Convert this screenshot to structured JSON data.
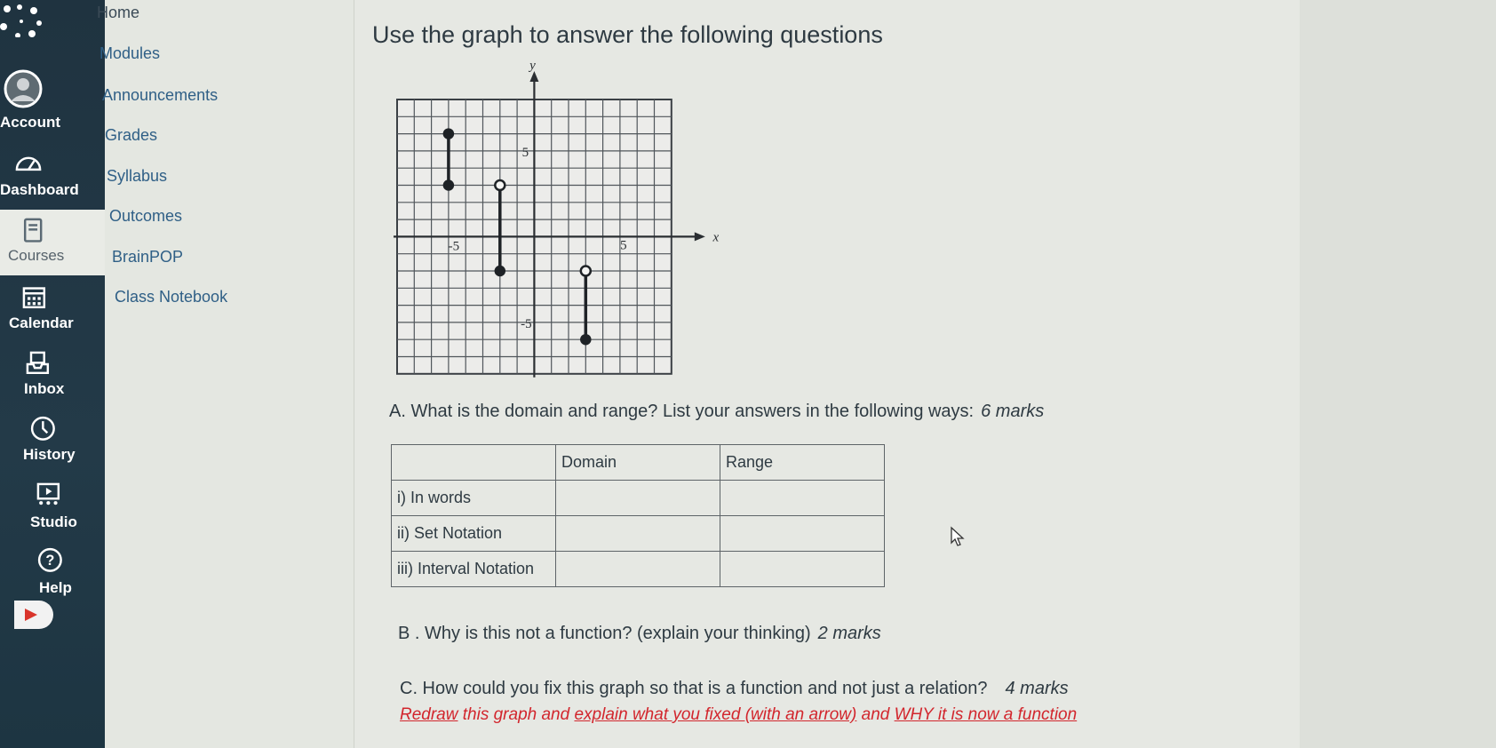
{
  "global_nav": {
    "items": [
      {
        "label": "Account",
        "icon": "account-icon"
      },
      {
        "label": "Dashboard",
        "icon": "dashboard-icon"
      },
      {
        "label": "Courses",
        "icon": "courses-icon",
        "active": true
      },
      {
        "label": "Calendar",
        "icon": "calendar-icon"
      },
      {
        "label": "Inbox",
        "icon": "inbox-icon"
      },
      {
        "label": "History",
        "icon": "history-icon"
      },
      {
        "label": "Studio",
        "icon": "studio-icon"
      },
      {
        "label": "Help",
        "icon": "help-icon"
      }
    ]
  },
  "course_nav": {
    "items": [
      "Home",
      "Modules",
      "Announcements",
      "Grades",
      "Syllabus",
      "Outcomes",
      "BrainPOP",
      "Class Notebook"
    ]
  },
  "page": {
    "title": "Use the graph to answer the following questions",
    "question_a": "A. What is the domain and range? List your answers in the following ways:",
    "question_a_marks": "6 marks",
    "question_b": "B . Why is this not a function? (explain your thinking)",
    "question_b_marks": "2 marks",
    "question_c": "C. How could you fix this graph so that is a function and not just a relation?",
    "question_c_marks": "4 marks",
    "redraw_parts": [
      "Redraw",
      " this graph and ",
      "explain what you fixed (with an arrow)",
      " and ",
      "WHY it is now a function"
    ]
  },
  "table": {
    "headers": [
      "",
      "Domain",
      "Range"
    ],
    "rows": [
      [
        "i) In words",
        "",
        ""
      ],
      [
        "ii) Set Notation",
        "",
        ""
      ],
      [
        "iii) Interval Notation",
        "",
        ""
      ]
    ]
  },
  "graph": {
    "axis_x_label": "x",
    "axis_y_label": "y",
    "tick_labels": {
      "x_neg": "-5",
      "x_pos": "5",
      "y_pos": "5",
      "y_neg": "-5"
    },
    "x_range": [
      -8,
      8
    ],
    "y_range": [
      -8,
      8
    ],
    "segments": [
      {
        "x": -5,
        "y_top": 6,
        "y_bottom": 3,
        "top": "closed",
        "bottom": "closed"
      },
      {
        "x": -2,
        "y_top": 3,
        "y_bottom": -2,
        "top": "open",
        "bottom": "closed"
      },
      {
        "x": 3,
        "y_top": -2,
        "y_bottom": -6,
        "top": "open",
        "bottom": "closed"
      }
    ]
  },
  "colors": {
    "nav_bg": "#1f3340",
    "link": "#2f5f86",
    "red": "#d2262d"
  }
}
